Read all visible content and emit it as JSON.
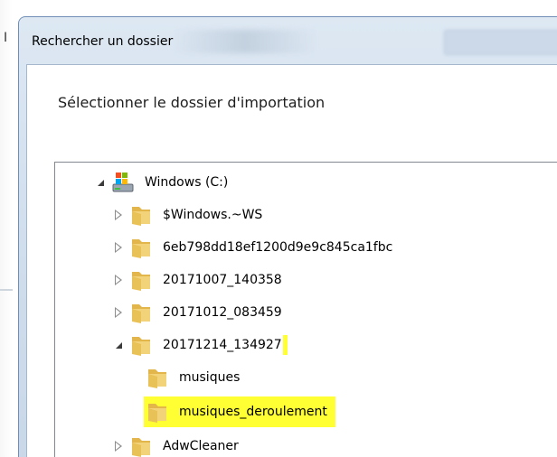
{
  "background_window": {
    "title_fragment": "I"
  },
  "dialog": {
    "title": "Rechercher un dossier",
    "instruction": "Sélectionner le dossier d'importation"
  },
  "tree": {
    "root": {
      "label": "Windows (C:)",
      "icon": "windows-drive-icon",
      "expanded": true
    },
    "items": [
      {
        "label": "$Windows.~WS",
        "expanded": false,
        "has_children": true
      },
      {
        "label": "6eb798dd18ef1200d9e9c845ca1fbc",
        "expanded": false,
        "has_children": true
      },
      {
        "label": "20171007_140358",
        "expanded": false,
        "has_children": true
      },
      {
        "label": "20171012_083459",
        "expanded": false,
        "has_children": true
      },
      {
        "label": "20171214_134927",
        "expanded": true,
        "has_children": true
      },
      {
        "label": "musiques",
        "expanded": false,
        "has_children": false
      },
      {
        "label": "musiques_deroulement",
        "expanded": false,
        "has_children": false
      },
      {
        "label": "AdwCleaner",
        "expanded": false,
        "has_children": true
      }
    ]
  },
  "colors": {
    "highlight": "#ffff33",
    "title_bar": "#d7e4f1",
    "folder": "#e8c157"
  }
}
